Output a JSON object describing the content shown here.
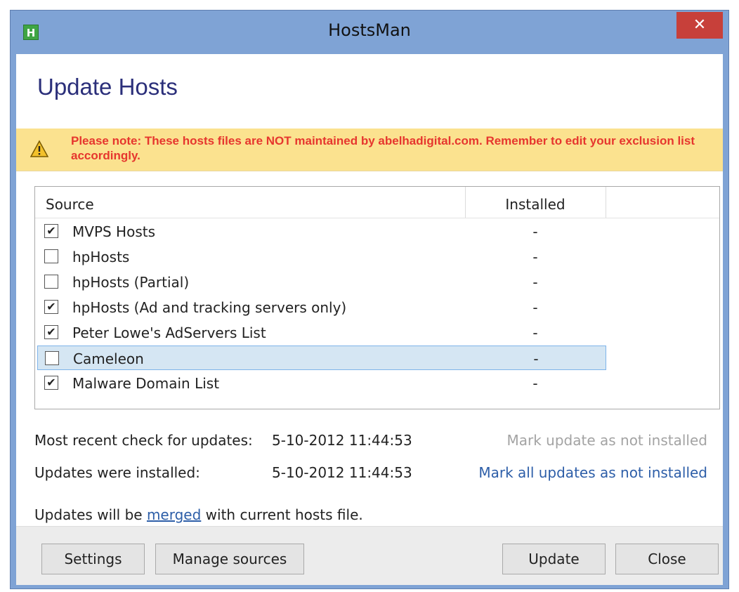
{
  "window": {
    "title": "HostsMan",
    "app_icon_letter": "H",
    "close_glyph": "✕"
  },
  "heading": "Update Hosts",
  "notice": {
    "icon": "warning-icon",
    "text": "Please note: These hosts files are NOT maintained by abelhadigital.com. Remember to edit your exclusion list accordingly."
  },
  "list": {
    "columns": [
      "Source",
      "Installed"
    ],
    "rows": [
      {
        "label": "MVPS Hosts",
        "checked": true,
        "installed": "-"
      },
      {
        "label": "hpHosts",
        "checked": false,
        "installed": "-"
      },
      {
        "label": "hpHosts (Partial)",
        "checked": false,
        "installed": "-"
      },
      {
        "label": "hpHosts (Ad and tracking servers only)",
        "checked": true,
        "installed": "-"
      },
      {
        "label": "Peter Lowe's AdServers List",
        "checked": true,
        "installed": "-"
      },
      {
        "label": "Cameleon",
        "checked": false,
        "installed": "-",
        "selected": true
      },
      {
        "label": "Malware Domain List",
        "checked": true,
        "installed": "-"
      }
    ],
    "check_glyph": "✔"
  },
  "info": {
    "recent_check_label": "Most recent check for updates:",
    "recent_check_value": "5-10-2012 11:44:53",
    "installed_label": "Updates were installed:",
    "installed_value": "5-10-2012 11:44:53",
    "mark_update_link": "Mark update as not installed",
    "mark_all_link": "Mark all updates as not installed",
    "merge_prefix": "Updates will be",
    "merge_link": "merged",
    "merge_suffix": "with current hosts file."
  },
  "buttons": {
    "settings": "Settings",
    "manage_sources": "Manage sources",
    "update": "Update",
    "close": "Close"
  },
  "colors": {
    "titlebar": "#7fa3d5",
    "close_button": "#c7403a",
    "heading": "#2b2f7a",
    "notice_bg": "#fbe28f",
    "notice_text": "#e6362e",
    "selected_row": "#d5e6f3",
    "link": "#2d5ea8"
  }
}
